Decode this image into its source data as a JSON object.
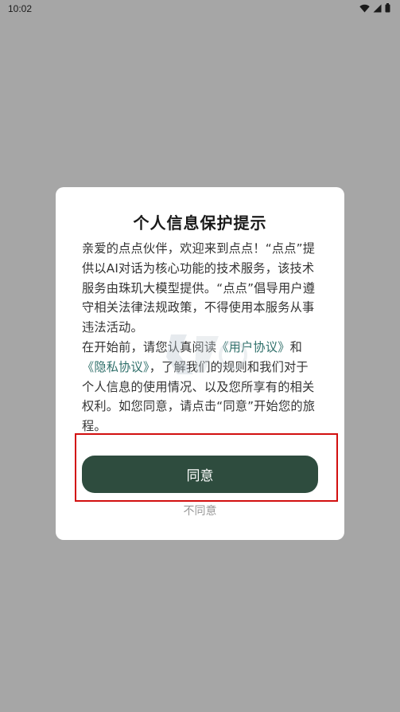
{
  "status_bar": {
    "time": "10:02"
  },
  "dialog": {
    "title": "个人信息保护提示",
    "paragraph1": "亲爱的点点伙伴，欢迎来到点点！“点点”提供以AI对话为核心功能的技术服务，该技术服务由珠玑大模型提供。“点点”倡导用户遵守相关法律法规政策，不得使用本服务从事违法活动。",
    "paragraph2_before": "在开始前，请您认真阅读",
    "user_agreement_link": "《用户协议》",
    "paragraph2_and": "和",
    "privacy_agreement_link": "《隐私协议》",
    "paragraph2_after": "，了解我们的规则和我们对于个人信息的使用情况、以及您所享有的相关权利。如您同意，请点击“同意”开始您的旅程。",
    "agree_label": "同意",
    "disagree_label": "不同意"
  },
  "colors": {
    "overlay": "#a6a6a6",
    "dialog_bg": "#ffffff",
    "button_bg": "#2e4c3e",
    "link": "#2f6f6a",
    "highlight_border": "#d20f0f"
  }
}
